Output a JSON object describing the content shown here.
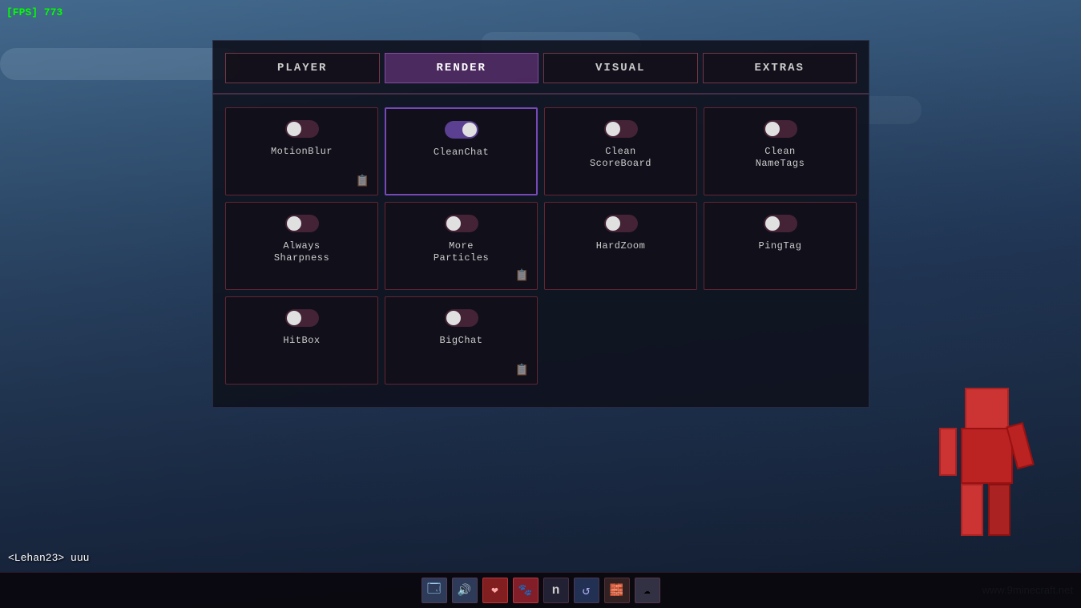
{
  "fps": {
    "label": "[FPS] 773",
    "bracket_open": "[FPS]",
    "value": "773"
  },
  "chat": {
    "line": "<Lehan23> uuu"
  },
  "watermark": "www.9minecraft.net",
  "tabs": [
    {
      "id": "player",
      "label": "PLAYER",
      "active": false
    },
    {
      "id": "render",
      "label": "RENDER",
      "active": true
    },
    {
      "id": "visual",
      "label": "VISUAL",
      "active": false
    },
    {
      "id": "extras",
      "label": "EXTRAS",
      "active": false
    }
  ],
  "modules": [
    {
      "id": "motion-blur",
      "label": "MotionBlur",
      "toggle": "off",
      "has_note": true,
      "active_card": false
    },
    {
      "id": "clean-chat",
      "label": "CleanChat",
      "toggle": "on",
      "has_note": false,
      "active_card": true
    },
    {
      "id": "clean-scoreboard",
      "label": "Clean\nScoreBoard",
      "toggle": "off",
      "has_note": false,
      "active_card": false
    },
    {
      "id": "clean-nametags",
      "label": "Clean\nNameTags",
      "toggle": "off",
      "has_note": false,
      "active_card": false
    },
    {
      "id": "always-sharpness",
      "label": "Always\nSharpness",
      "toggle": "off",
      "has_note": false,
      "active_card": false
    },
    {
      "id": "more-particles",
      "label": "More\nParticles",
      "toggle": "off",
      "has_note": true,
      "active_card": false
    },
    {
      "id": "hardzoom",
      "label": "HardZoom",
      "toggle": "off",
      "has_note": false,
      "active_card": false
    },
    {
      "id": "pingtag",
      "label": "PingTag",
      "toggle": "off",
      "has_note": false,
      "active_card": false
    },
    {
      "id": "hitbox",
      "label": "HitBox",
      "toggle": "off",
      "has_note": false,
      "active_card": false
    },
    {
      "id": "bigchat",
      "label": "BigChat",
      "toggle": "off",
      "has_note": true,
      "active_card": false
    }
  ],
  "toolbar": {
    "buttons": [
      "🗔",
      "🔊",
      "❤",
      "🐾",
      "n",
      "↺",
      "🧱",
      "☁"
    ]
  }
}
